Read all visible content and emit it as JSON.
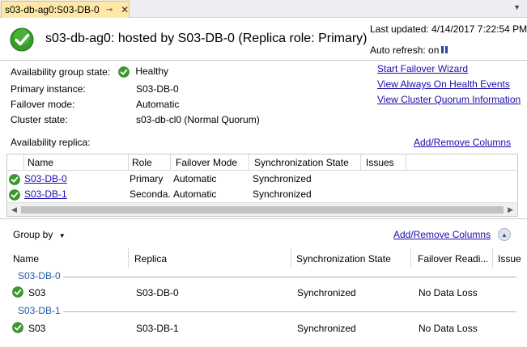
{
  "tab": {
    "title": "s03-db-ag0:S03-DB-0",
    "pin_glyph": "⊸",
    "close_glyph": "✕"
  },
  "header": {
    "title": "s03-db-ag0: hosted by S03-DB-0 (Replica role: Primary)",
    "last_updated_label": "Last updated: 4/14/2017 7:22:54 PM",
    "auto_refresh_label": "Auto refresh: on"
  },
  "info": {
    "ag_state_label": "Availability group state:",
    "ag_state_value": "Healthy",
    "primary_label": "Primary instance:",
    "primary_value": "S03-DB-0",
    "failover_label": "Failover mode:",
    "failover_value": "Automatic",
    "cluster_label": "Cluster state:",
    "cluster_value": "s03-db-cl0 (Normal Quorum)"
  },
  "links": {
    "start_failover": "Start Failover Wizard",
    "view_health": "View Always On Health Events",
    "view_quorum": "View Cluster Quorum Information"
  },
  "replica_section": {
    "label": "Availability replica:",
    "add_remove": "Add/Remove Columns",
    "columns": [
      "Name",
      "Role",
      "Failover Mode",
      "Synchronization State",
      "Issues"
    ],
    "rows": [
      {
        "name": "S03-DB-0",
        "role": "Primary",
        "failover": "Automatic",
        "sync": "Synchronized",
        "issues": ""
      },
      {
        "name": "S03-DB-1",
        "role": "Seconda...",
        "failover": "Automatic",
        "sync": "Synchronized",
        "issues": ""
      }
    ]
  },
  "database_section": {
    "group_by": "Group by",
    "add_remove": "Add/Remove Columns",
    "columns": [
      "Name",
      "Replica",
      "Synchronization State",
      "Failover Readi...",
      "Issue"
    ],
    "groups": [
      {
        "header": "S03-DB-0",
        "row": {
          "name": "S03",
          "replica": "S03-DB-0",
          "sync": "Synchronized",
          "failover": "No Data Loss"
        }
      },
      {
        "header": "S03-DB-1",
        "row": {
          "name": "S03",
          "replica": "S03-DB-1",
          "sync": "Synchronized",
          "failover": "No Data Loss"
        }
      }
    ]
  },
  "colors": {
    "tab_active": "#ffe8a6",
    "link": "#1a0dab",
    "group_header": "#1f5ca8",
    "check_green": "#3a9a2a"
  }
}
